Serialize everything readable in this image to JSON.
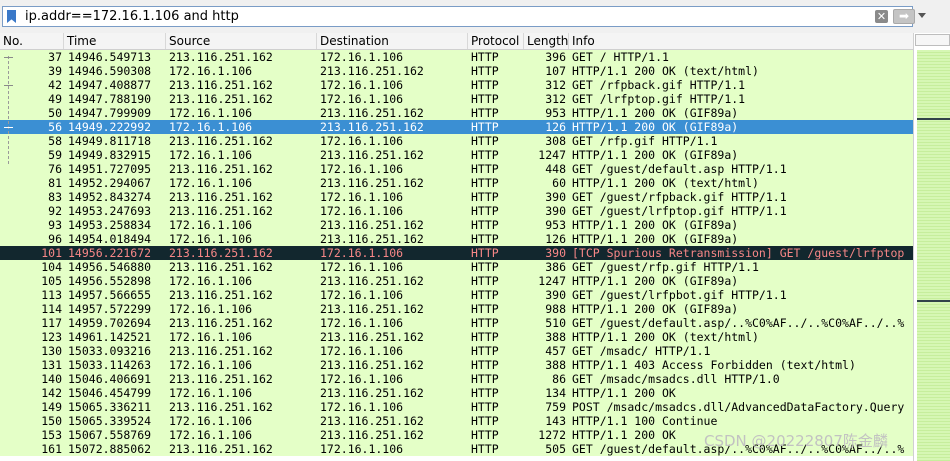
{
  "filter": {
    "text": "ip.addr==172.16.1.106 and http",
    "clear_glyph": "✕",
    "apply_glyph": "➡"
  },
  "columns": [
    "No.",
    "Time",
    "Source",
    "Destination",
    "Protocol",
    "Length",
    "Info"
  ],
  "rows": [
    {
      "no": "37",
      "time": "14946.549713",
      "src": "213.116.251.162",
      "dst": "172.16.1.106",
      "proto": "HTTP",
      "len": "396",
      "info": "GET / HTTP/1.1",
      "state": "normal"
    },
    {
      "no": "39",
      "time": "14946.590308",
      "src": "172.16.1.106",
      "dst": "213.116.251.162",
      "proto": "HTTP",
      "len": "107",
      "info": "HTTP/1.1 200 OK  (text/html)",
      "state": "normal"
    },
    {
      "no": "42",
      "time": "14947.408877",
      "src": "213.116.251.162",
      "dst": "172.16.1.106",
      "proto": "HTTP",
      "len": "312",
      "info": "GET /rfpback.gif HTTP/1.1",
      "state": "normal"
    },
    {
      "no": "49",
      "time": "14947.788190",
      "src": "213.116.251.162",
      "dst": "172.16.1.106",
      "proto": "HTTP",
      "len": "312",
      "info": "GET /lrfptop.gif HTTP/1.1",
      "state": "normal"
    },
    {
      "no": "50",
      "time": "14947.799909",
      "src": "172.16.1.106",
      "dst": "213.116.251.162",
      "proto": "HTTP",
      "len": "953",
      "info": "HTTP/1.1 200 OK  (GIF89a)",
      "state": "normal"
    },
    {
      "no": "56",
      "time": "14949.222992",
      "src": "172.16.1.106",
      "dst": "213.116.251.162",
      "proto": "HTTP",
      "len": "126",
      "info": "HTTP/1.1 200 OK  (GIF89a)",
      "state": "selected"
    },
    {
      "no": "58",
      "time": "14949.811718",
      "src": "213.116.251.162",
      "dst": "172.16.1.106",
      "proto": "HTTP",
      "len": "308",
      "info": "GET /rfp.gif HTTP/1.1",
      "state": "normal"
    },
    {
      "no": "59",
      "time": "14949.832915",
      "src": "172.16.1.106",
      "dst": "213.116.251.162",
      "proto": "HTTP",
      "len": "1247",
      "info": "HTTP/1.1 200 OK  (GIF89a)",
      "state": "normal"
    },
    {
      "no": "76",
      "time": "14951.727095",
      "src": "213.116.251.162",
      "dst": "172.16.1.106",
      "proto": "HTTP",
      "len": "448",
      "info": "GET /guest/default.asp HTTP/1.1",
      "state": "normal"
    },
    {
      "no": "81",
      "time": "14952.294067",
      "src": "172.16.1.106",
      "dst": "213.116.251.162",
      "proto": "HTTP",
      "len": "60",
      "info": "HTTP/1.1 200 OK  (text/html)",
      "state": "normal"
    },
    {
      "no": "83",
      "time": "14952.843274",
      "src": "213.116.251.162",
      "dst": "172.16.1.106",
      "proto": "HTTP",
      "len": "390",
      "info": "GET /guest/rfpback.gif HTTP/1.1",
      "state": "normal"
    },
    {
      "no": "92",
      "time": "14953.247693",
      "src": "213.116.251.162",
      "dst": "172.16.1.106",
      "proto": "HTTP",
      "len": "390",
      "info": "GET /guest/lrfptop.gif HTTP/1.1",
      "state": "normal"
    },
    {
      "no": "93",
      "time": "14953.258834",
      "src": "172.16.1.106",
      "dst": "213.116.251.162",
      "proto": "HTTP",
      "len": "953",
      "info": "HTTP/1.1 200 OK  (GIF89a)",
      "state": "normal"
    },
    {
      "no": "96",
      "time": "14954.018494",
      "src": "172.16.1.106",
      "dst": "213.116.251.162",
      "proto": "HTTP",
      "len": "126",
      "info": "HTTP/1.1 200 OK  (GIF89a)",
      "state": "normal"
    },
    {
      "no": "101",
      "time": "14956.221672",
      "src": "213.116.251.162",
      "dst": "172.16.1.106",
      "proto": "HTTP",
      "len": "390",
      "info": "[TCP Spurious Retransmission] GET /guest/lrfptop",
      "state": "error"
    },
    {
      "no": "104",
      "time": "14956.546880",
      "src": "213.116.251.162",
      "dst": "172.16.1.106",
      "proto": "HTTP",
      "len": "386",
      "info": "GET /guest/rfp.gif HTTP/1.1",
      "state": "normal"
    },
    {
      "no": "105",
      "time": "14956.552898",
      "src": "172.16.1.106",
      "dst": "213.116.251.162",
      "proto": "HTTP",
      "len": "1247",
      "info": "HTTP/1.1 200 OK  (GIF89a)",
      "state": "normal"
    },
    {
      "no": "113",
      "time": "14957.566655",
      "src": "213.116.251.162",
      "dst": "172.16.1.106",
      "proto": "HTTP",
      "len": "390",
      "info": "GET /guest/lrfpbot.gif HTTP/1.1",
      "state": "normal"
    },
    {
      "no": "114",
      "time": "14957.572299",
      "src": "172.16.1.106",
      "dst": "213.116.251.162",
      "proto": "HTTP",
      "len": "988",
      "info": "HTTP/1.1 200 OK  (GIF89a)",
      "state": "normal"
    },
    {
      "no": "117",
      "time": "14959.702694",
      "src": "213.116.251.162",
      "dst": "172.16.1.106",
      "proto": "HTTP",
      "len": "510",
      "info": "GET /guest/default.asp/..%C0%AF../..%C0%AF../..%",
      "state": "normal"
    },
    {
      "no": "123",
      "time": "14961.142521",
      "src": "172.16.1.106",
      "dst": "213.116.251.162",
      "proto": "HTTP",
      "len": "388",
      "info": "HTTP/1.1 200 OK  (text/html)",
      "state": "normal"
    },
    {
      "no": "130",
      "time": "15033.093216",
      "src": "213.116.251.162",
      "dst": "172.16.1.106",
      "proto": "HTTP",
      "len": "457",
      "info": "GET /msadc/ HTTP/1.1",
      "state": "normal"
    },
    {
      "no": "131",
      "time": "15033.114263",
      "src": "172.16.1.106",
      "dst": "213.116.251.162",
      "proto": "HTTP",
      "len": "388",
      "info": "HTTP/1.1 403 Access Forbidden  (text/html)",
      "state": "normal"
    },
    {
      "no": "140",
      "time": "15046.406691",
      "src": "213.116.251.162",
      "dst": "172.16.1.106",
      "proto": "HTTP",
      "len": "86",
      "info": "GET /msadc/msadcs.dll HTTP/1.0",
      "state": "normal"
    },
    {
      "no": "142",
      "time": "15046.454799",
      "src": "172.16.1.106",
      "dst": "213.116.251.162",
      "proto": "HTTP",
      "len": "134",
      "info": "HTTP/1.1 200 OK",
      "state": "normal"
    },
    {
      "no": "149",
      "time": "15065.336211",
      "src": "213.116.251.162",
      "dst": "172.16.1.106",
      "proto": "HTTP",
      "len": "759",
      "info": "POST /msadc/msadcs.dll/AdvancedDataFactory.Query",
      "state": "normal"
    },
    {
      "no": "150",
      "time": "15065.339524",
      "src": "172.16.1.106",
      "dst": "213.116.251.162",
      "proto": "HTTP",
      "len": "143",
      "info": "HTTP/1.1 100 Continue",
      "state": "normal"
    },
    {
      "no": "153",
      "time": "15067.558769",
      "src": "172.16.1.106",
      "dst": "213.116.251.162",
      "proto": "HTTP",
      "len": "1272",
      "info": "HTTP/1.1 200 OK",
      "state": "normal"
    },
    {
      "no": "161",
      "time": "15072.885062",
      "src": "213.116.251.162",
      "dst": "172.16.1.106",
      "proto": "HTTP",
      "len": "505",
      "info": "GET /guest/default.asp/..%C0%AF../..%C0%AF../..%",
      "state": "normal"
    }
  ],
  "watermark": "CSDN @20222807陈金麟",
  "colors": {
    "http_row": "#e4ffc7",
    "selected_row": "#3b8fd3",
    "error_row": "#12272e",
    "error_text": "#f78787"
  }
}
